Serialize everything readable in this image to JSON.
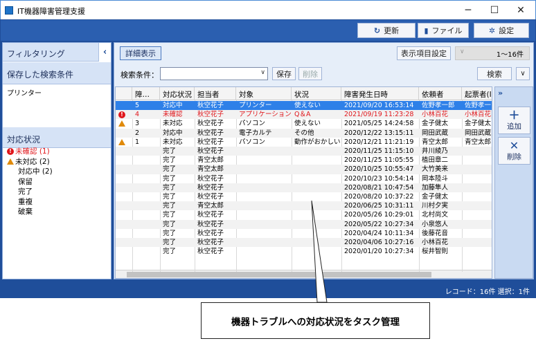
{
  "window": {
    "title": "IT機器障害管理支援",
    "minimize": "─",
    "maximize": "☐",
    "close": "✕"
  },
  "toolbar": {
    "update": "更新",
    "file": "ファイル",
    "settings": "設定"
  },
  "left": {
    "filtering": "フィルタリング",
    "collapse": "‹",
    "saved_header": "保存した検索条件",
    "saved_item": "プリンター",
    "status_header": "対応状況",
    "statuses": [
      {
        "label": "未確認 (1)",
        "icon": "error",
        "color": "#e0161b"
      },
      {
        "label": "未対応 (2)",
        "icon": "warning"
      },
      {
        "label": "対応中 (2)"
      },
      {
        "label": "保留"
      },
      {
        "label": "完了"
      },
      {
        "label": "重複"
      },
      {
        "label": "破棄"
      }
    ]
  },
  "main": {
    "detail_button": "詳細表示",
    "display_settings": "表示項目設定",
    "range": "1〜16件",
    "search_label": "検索条件：",
    "save": "保存",
    "delete": "削除",
    "search": "検索",
    "expand": "∨",
    "columns": [
      "障…",
      "対応状況",
      "担当者",
      "対象",
      "状況",
      "障害発生日時",
      "依頼者",
      "起票者(I"
    ],
    "rows": [
      {
        "icon": "",
        "no": "5",
        "status": "対応中",
        "assignee": "秋空花子",
        "target": "プリンター",
        "state": "使えない",
        "date": "2021/09/20 16:53:14",
        "requester": "佐野孝一郎",
        "reporter": "佐野孝一",
        "selected": true
      },
      {
        "icon": "error",
        "no": "4",
        "status": "未確認",
        "assignee": "秋空花子",
        "target": "アプリケーション",
        "state": "Q＆A",
        "date": "2021/09/19 11:23:28",
        "requester": "小林百花",
        "reporter": "小林百花",
        "red": true
      },
      {
        "icon": "warning",
        "no": "3",
        "status": "未対応",
        "assignee": "秋空花子",
        "target": "パソコン",
        "state": "使えない",
        "date": "2021/05/25 14:24:58",
        "requester": "金子健太",
        "reporter": "金子健太"
      },
      {
        "icon": "",
        "no": "2",
        "status": "対応中",
        "assignee": "秋空花子",
        "target": "電子カルテ",
        "state": "その他",
        "date": "2020/12/22 13:15:11",
        "requester": "岡田武蔵",
        "reporter": "岡田武蔵"
      },
      {
        "icon": "warning",
        "no": "1",
        "status": "未対応",
        "assignee": "秋空花子",
        "target": "パソコン",
        "state": "動作がおかしい",
        "date": "2020/12/21 11:21:19",
        "requester": "青空太郎",
        "reporter": "青空太郎"
      },
      {
        "icon": "",
        "no": "",
        "status": "完了",
        "assignee": "秋空花子",
        "target": "",
        "state": "",
        "date": "2020/11/25 11:15:10",
        "requester": "井川綾乃",
        "reporter": ""
      },
      {
        "icon": "",
        "no": "",
        "status": "完了",
        "assignee": "青空太郎",
        "target": "",
        "state": "",
        "date": "2020/11/25 11:05:55",
        "requester": "植田章二",
        "reporter": ""
      },
      {
        "icon": "",
        "no": "",
        "status": "完了",
        "assignee": "青空太郎",
        "target": "",
        "state": "",
        "date": "2020/10/25 10:55:47",
        "requester": "大竹美来",
        "reporter": ""
      },
      {
        "icon": "",
        "no": "",
        "status": "完了",
        "assignee": "秋空花子",
        "target": "",
        "state": "",
        "date": "2020/10/23 10:54:14",
        "requester": "岡本陸斗",
        "reporter": ""
      },
      {
        "icon": "",
        "no": "",
        "status": "完了",
        "assignee": "秋空花子",
        "target": "",
        "state": "",
        "date": "2020/08/21 10:47:54",
        "requester": "加藤隼人",
        "reporter": ""
      },
      {
        "icon": "",
        "no": "",
        "status": "完了",
        "assignee": "秋空花子",
        "target": "",
        "state": "",
        "date": "2020/08/20 10:37:22",
        "requester": "金子健太",
        "reporter": ""
      },
      {
        "icon": "",
        "no": "",
        "status": "完了",
        "assignee": "青空太郎",
        "target": "",
        "state": "",
        "date": "2020/06/25 10:31:11",
        "requester": "川村夕実",
        "reporter": ""
      },
      {
        "icon": "",
        "no": "",
        "status": "完了",
        "assignee": "秋空花子",
        "target": "",
        "state": "",
        "date": "2020/05/26 10:29:01",
        "requester": "北村尚文",
        "reporter": ""
      },
      {
        "icon": "",
        "no": "",
        "status": "完了",
        "assignee": "秋空花子",
        "target": "",
        "state": "",
        "date": "2020/05/22 10:27:34",
        "requester": "小泉悠人",
        "reporter": ""
      },
      {
        "icon": "",
        "no": "",
        "status": "完了",
        "assignee": "秋空花子",
        "target": "",
        "state": "",
        "date": "2020/04/24 10:11:34",
        "requester": "後藤花音",
        "reporter": ""
      },
      {
        "icon": "",
        "no": "",
        "status": "完了",
        "assignee": "秋空花子",
        "target": "",
        "state": "",
        "date": "2020/04/06 10:27:16",
        "requester": "小林百花",
        "reporter": ""
      },
      {
        "icon": "",
        "no": "",
        "status": "完了",
        "assignee": "秋空花子",
        "target": "",
        "state": "",
        "date": "2020/01/20 10:27:34",
        "requester": "桜井智則",
        "reporter": ""
      }
    ]
  },
  "side": {
    "expand": "»",
    "add": "追加",
    "remove": "削除"
  },
  "status_bar": "レコード：16件 選択：1件",
  "caption": "機器トラブルへの対応状況をタスク管理"
}
